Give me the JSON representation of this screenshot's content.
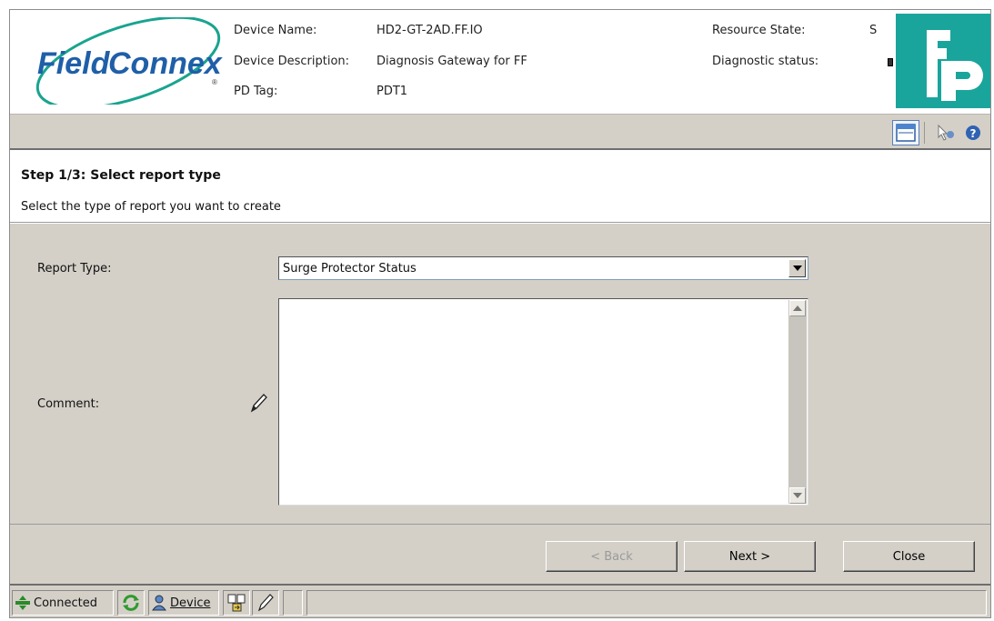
{
  "header": {
    "logo_text_a": "Field",
    "logo_text_b": "Connex",
    "device_name_label": "Device Name:",
    "device_name_value": "HD2-GT-2AD.FF.IO",
    "device_description_label": "Device Description:",
    "device_description_value": "Diagnosis Gateway for FF",
    "pd_tag_label": "PD Tag:",
    "pd_tag_value": "PDT1",
    "resource_state_label": "Resource State:",
    "resource_state_value": "S",
    "diagnostic_status_label": "Diagnostic status:"
  },
  "toolbar": {
    "icons": [
      "window-view-icon",
      "pointer-help-icon",
      "help-icon"
    ]
  },
  "step": {
    "title": "Step 1/3: Select report type",
    "description": "Select the type of report you want to create"
  },
  "form": {
    "report_type_label": "Report Type:",
    "report_type_value": "Surge Protector Status",
    "comment_label": "Comment:",
    "comment_value": ""
  },
  "buttons": {
    "back": "< Back",
    "next": "Next >",
    "close": "Close"
  },
  "statusbar": {
    "connection": "Connected",
    "device": "Device"
  },
  "colors": {
    "panel": "#d4d0c8",
    "brand_teal": "#1aa59c",
    "logo_blue": "#1f5fa8"
  }
}
